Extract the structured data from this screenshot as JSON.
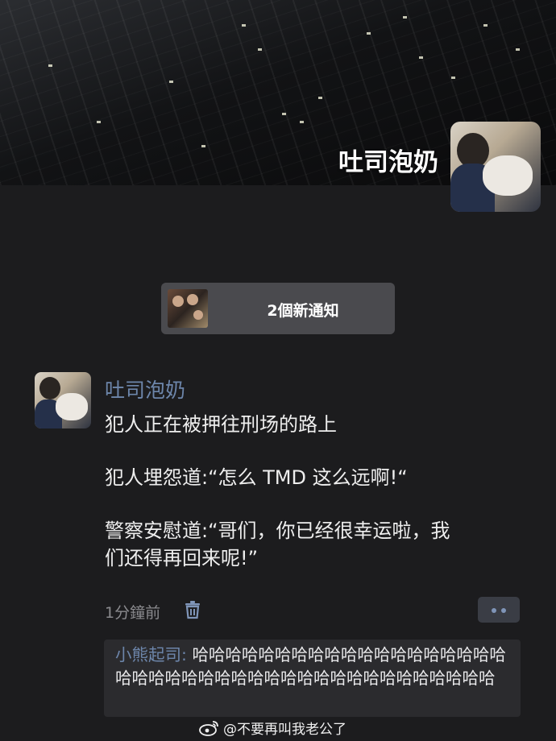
{
  "profile": {
    "cover_name": "吐司泡奶"
  },
  "notification": {
    "label": "2個新通知"
  },
  "post": {
    "author": "吐司泡奶",
    "lines": [
      "犯人正在被押往刑场的路上",
      "犯人埋怨道:“怎么 TMD 这么远啊!“",
      "警察安慰道:“哥们，你已经很幸运啦，我",
      "们还得再回来呢!”"
    ],
    "time": "1分鐘前",
    "icons": {
      "delete": "trash-icon",
      "more": "more-dots-icon"
    }
  },
  "comment": {
    "author": "小熊起司",
    "separator": ": ",
    "text": "哈哈哈哈哈哈哈哈哈哈哈哈哈哈哈哈哈哈哈哈哈哈哈哈哈哈哈哈哈哈哈哈哈哈哈哈哈哈哈哈哈哈"
  },
  "watermark": {
    "text": "@不要再叫我老公了",
    "icon": "weibo-icon"
  },
  "colors": {
    "background": "#1c1c1e",
    "link_blue": "#6d86ab",
    "notification_bg": "#4a4a4e",
    "comment_bg": "#2b2b2e"
  }
}
